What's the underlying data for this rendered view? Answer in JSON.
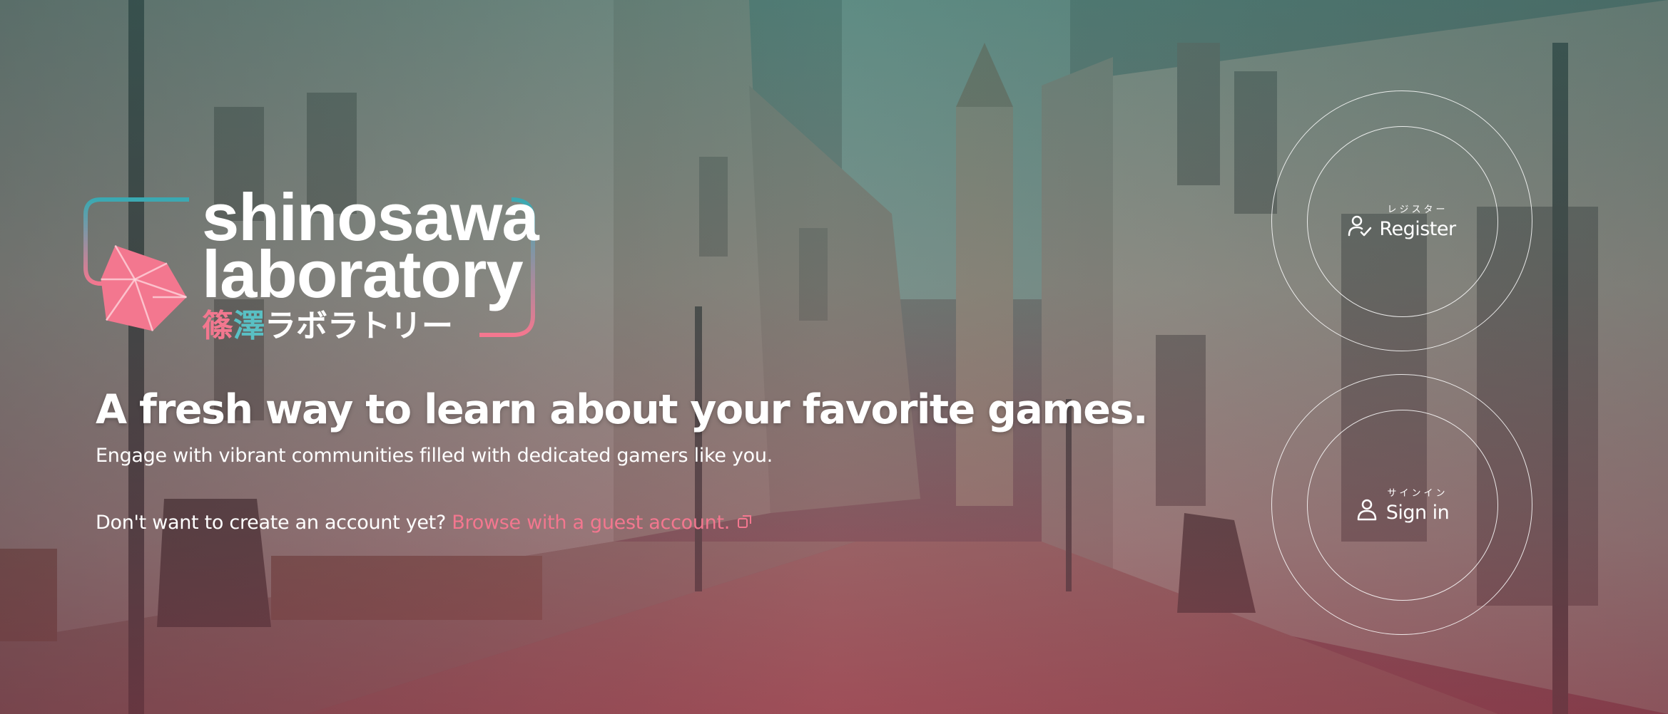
{
  "logo": {
    "line1": "shinosawa",
    "line2": "laboratory",
    "jp_part1": "篠",
    "jp_part2": "澤",
    "jp_part3": "ラボラトリー"
  },
  "hero": {
    "headline": "A fresh way to learn about your favorite games.",
    "subline": "Engage with vibrant communities filled with dedicated gamers like you.",
    "guest_prompt": "Don't want to create an account yet?",
    "guest_link": "Browse with a guest account."
  },
  "actions": {
    "register": {
      "kana": "レジスター",
      "label": "Register",
      "icon": "user-check-icon"
    },
    "signin": {
      "kana": "サインイン",
      "label": "Sign in",
      "icon": "user-icon"
    }
  },
  "colors": {
    "accent_pink": "#f3778f",
    "accent_teal": "#59c0c4"
  }
}
